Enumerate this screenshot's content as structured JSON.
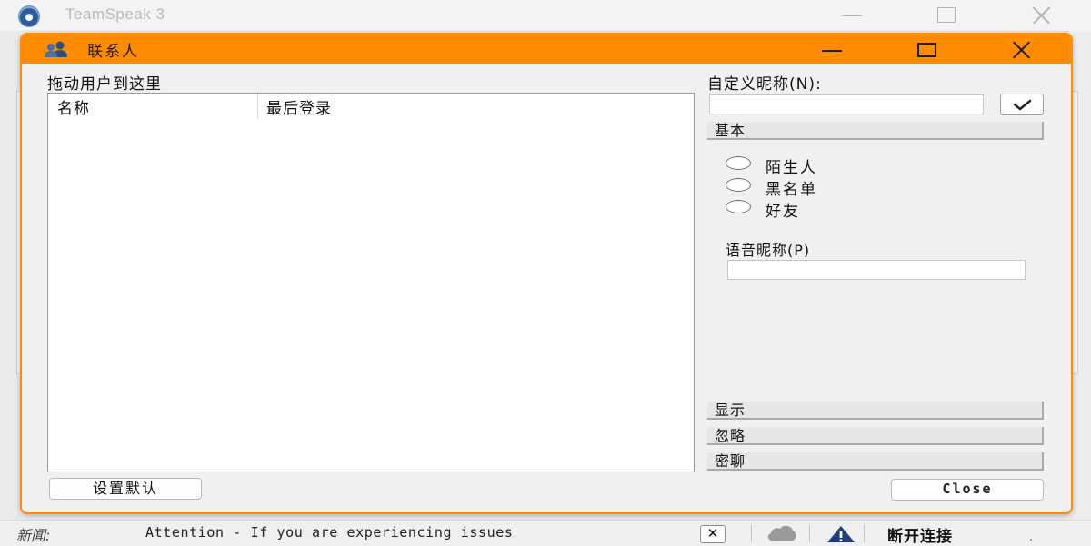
{
  "main_window": {
    "title": "TeamSpeak 3"
  },
  "dialog": {
    "title": "联系人",
    "drag_hint": "拖动用户到这里",
    "list": {
      "columns": [
        "名称",
        "最后登录"
      ],
      "rows": []
    },
    "set_default_label": "设置默认",
    "custom_nickname_label": "自定义昵称(N):",
    "custom_nickname_value": "",
    "sections": {
      "basic": "基本",
      "display": "显示",
      "ignore": "忽略",
      "whisper": "密聊"
    },
    "radio_options": [
      "陌生人",
      "黑名单",
      "好友"
    ],
    "voice_nickname_label": "语音昵称(P)",
    "voice_nickname_value": "",
    "close_label": "Close"
  },
  "status_bar": {
    "news_label": "新闻:",
    "news_text": "Attention - If you are experiencing issues",
    "connection_status": "断开连接"
  },
  "colors": {
    "dialog_accent": "#ff8c00",
    "warning_icon": "#1f3f7a"
  }
}
